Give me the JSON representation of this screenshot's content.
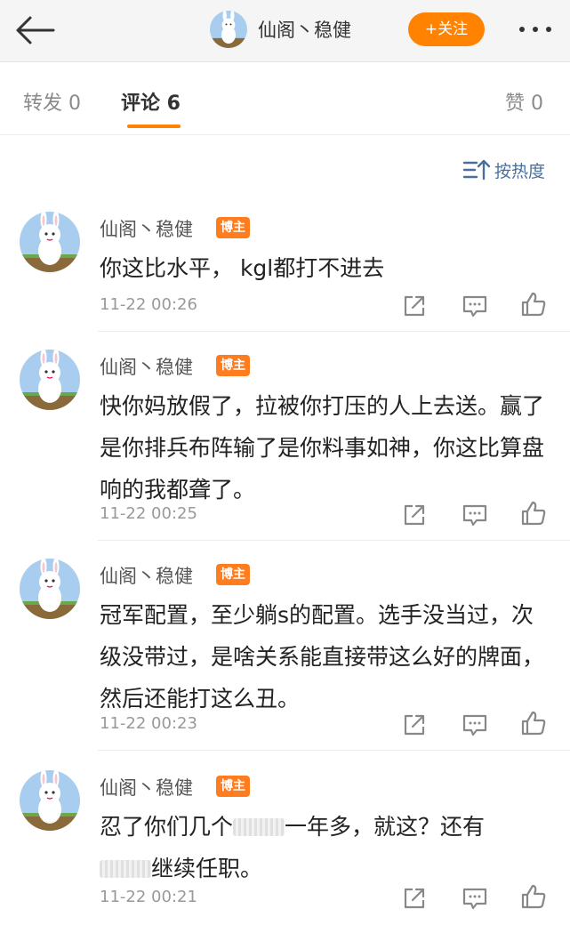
{
  "header": {
    "author_name": "仙阁丶稳健",
    "follow_label": "+关注"
  },
  "tabs": {
    "repost": "转发 0",
    "comments": "评论 6",
    "likes": "赞 0"
  },
  "sort": {
    "label": "按热度"
  },
  "comments": [
    {
      "name": "仙阁丶稳健",
      "badge": "博主",
      "text": "你这比水平， kgl都打不进去",
      "time": "11-22 00:26"
    },
    {
      "name": "仙阁丶稳健",
      "badge": "博主",
      "text": "快你妈放假了，拉被你打压的人上去送。赢了是你排兵布阵输了是你料事如神，你这比算盘响的我都聋了。",
      "time": "11-22 00:25"
    },
    {
      "name": "仙阁丶稳健",
      "badge": "博主",
      "text": "冠军配置，至少躺s的配置。选手没当过，次级没带过，是啥关系能直接带这么好的牌面，然后还能打这么丑。",
      "time": "11-22 00:23"
    },
    {
      "name": "仙阁丶稳健",
      "badge": "博主",
      "text_part1": "忍了你们几个",
      "text_part2": "一年多，就这？还有",
      "text_part3": "继续任职。",
      "time": "11-22 00:21"
    }
  ],
  "colors": {
    "accent": "#ff8200",
    "link": "#4a6f9e",
    "badge": "#ff7d1f"
  }
}
